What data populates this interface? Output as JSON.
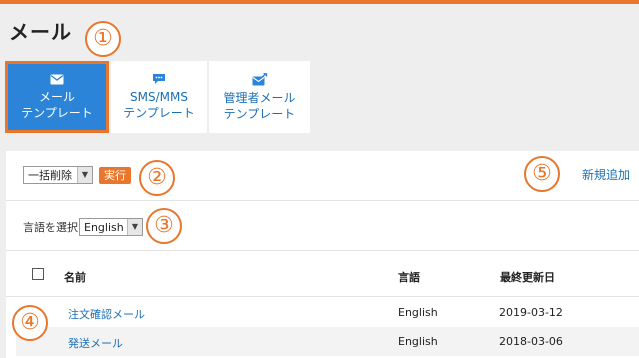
{
  "page": {
    "title": "メール"
  },
  "callouts": [
    "①",
    "②",
    "③",
    "④",
    "⑤"
  ],
  "tabs": [
    {
      "line1": "メール",
      "line2": "テンプレート",
      "icon": "envelope-icon",
      "active": true
    },
    {
      "line1": "SMS/MMS",
      "line2": "テンプレート",
      "icon": "chat-icon",
      "active": false
    },
    {
      "line1": "管理者メール",
      "line2": "テンプレート",
      "icon": "admin-mail-icon",
      "active": false
    }
  ],
  "toolbar": {
    "bulk_action_value": "一括削除",
    "run_label": "実行",
    "add_label": "新規追加"
  },
  "language": {
    "label": "言語を選択:",
    "value": "English"
  },
  "table": {
    "headers": {
      "name": "名前",
      "language": "言語",
      "updated": "最終更新日"
    },
    "rows": [
      {
        "name": "注文確認メール",
        "language": "English",
        "updated": "2019-03-12"
      },
      {
        "name": "発送メール",
        "language": "English",
        "updated": "2018-03-06"
      }
    ]
  },
  "colors": {
    "accent": "#e8762d",
    "primary": "#2b84d8",
    "link": "#1a6fb6"
  }
}
